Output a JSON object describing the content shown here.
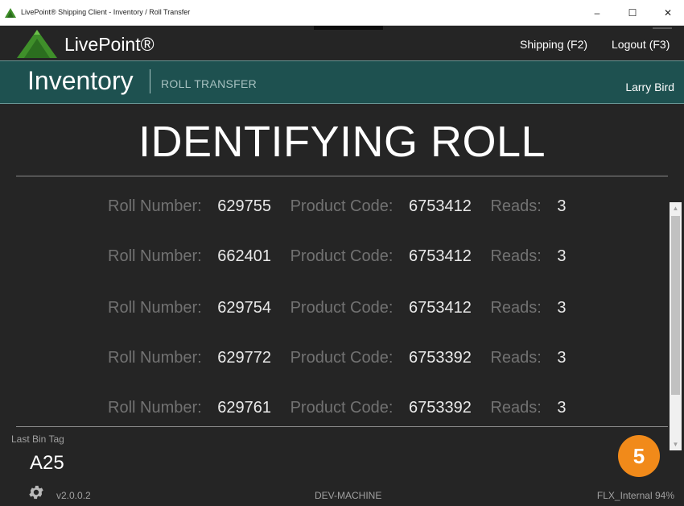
{
  "window": {
    "title": "LivePoint® Shipping Client - Inventory / Roll Transfer",
    "minimize_glyph": "–",
    "maximize_glyph": "☐",
    "close_glyph": "✕"
  },
  "header": {
    "brand": "LivePoint®",
    "nav": {
      "shipping": "Shipping (F2)",
      "logout": "Logout (F3)"
    }
  },
  "section": {
    "title": "Inventory",
    "subtitle": "ROLL TRANSFER",
    "user": "Larry Bird"
  },
  "status_title": "IDENTIFYING ROLL",
  "rolls": {
    "labels": {
      "roll_number": "Roll Number:",
      "product_code": "Product Code:",
      "reads": "Reads:"
    },
    "items": [
      {
        "roll_number": "629755",
        "product_code": "6753412",
        "reads": "3"
      },
      {
        "roll_number": "662401",
        "product_code": "6753412",
        "reads": "3"
      },
      {
        "roll_number": "629754",
        "product_code": "6753412",
        "reads": "3"
      },
      {
        "roll_number": "629772",
        "product_code": "6753392",
        "reads": "3"
      },
      {
        "roll_number": "629761",
        "product_code": "6753392",
        "reads": "3"
      }
    ]
  },
  "footer": {
    "last_bin_tag_label": "Last Bin Tag",
    "last_bin_tag": "A25",
    "count_badge": "5",
    "version": "v2.0.0.2",
    "machine": "DEV-MACHINE",
    "network": "FLX_Internal",
    "signal": "94%"
  },
  "colors": {
    "accent_teal": "#1e5150",
    "badge_orange": "#f18a1a",
    "background": "#252525",
    "logo_green": "#3f8f2a"
  },
  "icons": {
    "logo": "triangle-logo-icon",
    "settings": "gear-icon"
  }
}
